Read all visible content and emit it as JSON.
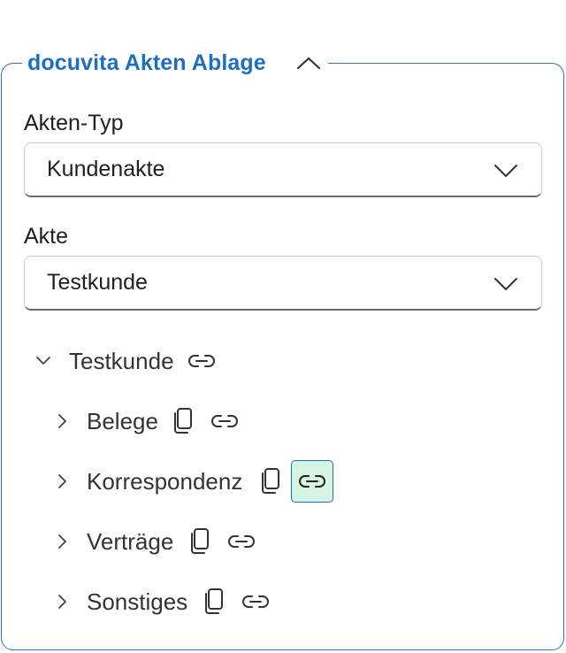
{
  "panel": {
    "title": "docuvita Akten Ablage",
    "collapse_icon": "chevron-up-icon",
    "accent_color": "#1f6fc1",
    "active_highlight": "#d6f5e3"
  },
  "akten_typ": {
    "label": "Akten-Typ",
    "value": "Kundenakte"
  },
  "akte": {
    "label": "Akte",
    "value": "Testkunde"
  },
  "tree": {
    "root": {
      "label": "Testkunde",
      "expanded": true
    },
    "children": [
      {
        "label": "Belege",
        "link_active": false
      },
      {
        "label": "Korrespondenz",
        "link_active": true
      },
      {
        "label": "Verträge",
        "link_active": false
      },
      {
        "label": "Sonstiges",
        "link_active": false
      }
    ]
  }
}
